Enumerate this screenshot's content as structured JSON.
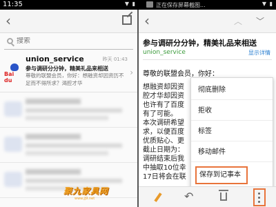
{
  "status_bar": {
    "time": "11:35",
    "saving_text": "正在保存屏幕截图..."
  },
  "left_pane": {
    "search_placeholder": "搜索",
    "mail": {
      "avatar_text": "Bai du",
      "sender": "union_service",
      "time": "昨天 01:43",
      "subject": "参与调研分分钟，精美礼品来相送",
      "preview": "尊敬的联盟会员，你好：想融资却因资历不足而不得所求？渴腔才华"
    }
  },
  "right_pane": {
    "subject": "参与调研分分钟，精美礼品来相送",
    "sender": "union_service",
    "details_link": "显示详情",
    "greeting": "尊敬的联盟会员，你好：",
    "body_lines": "想融资却因资\n腔才华却因资\n也许有了百度\n有了可能。\n本次调研希望\n求，以便百度\n优质贴心、更\n截止日期为：\n调研结束后我\n中抽取10位幸\n17日将会在联",
    "menu": [
      "彻底删除",
      "拒收",
      "标签",
      "移动邮件",
      "保存到记事本"
    ]
  },
  "watermark": {
    "text": "聚九家具网",
    "sub": "www.jj9.net"
  },
  "colors": {
    "accent_orange": "#e8733a",
    "sender_green": "#3a9a3a",
    "link_blue": "#2a7fd0"
  }
}
